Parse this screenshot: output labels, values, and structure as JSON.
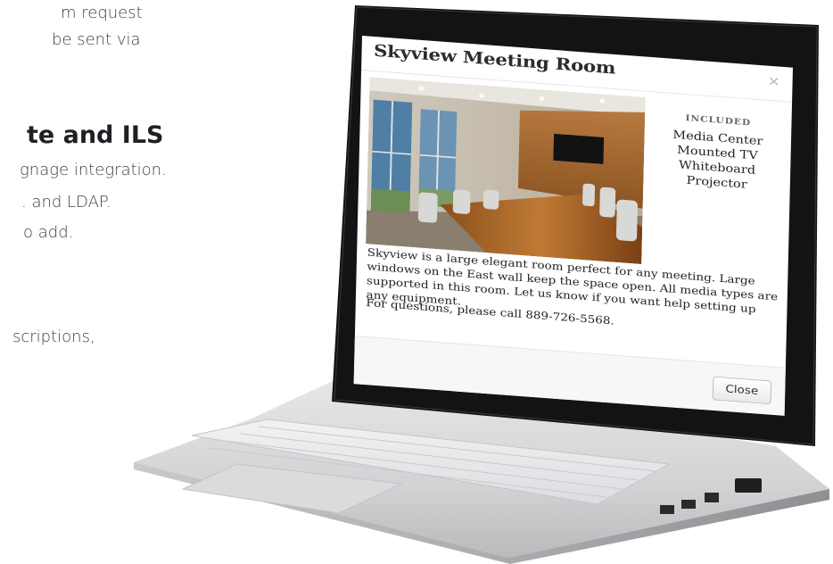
{
  "background_text": {
    "line1": "m request",
    "line2": "be sent via",
    "heading": "te and ILS",
    "line3": "gnage integration.",
    "line4": ". and LDAP.",
    "line5": "o add.",
    "line6": "scriptions,"
  },
  "modal": {
    "title": "Skyview Meeting Room",
    "close_icon": "×",
    "included": {
      "heading": "INCLUDED",
      "items": [
        "Media Center",
        "Mounted TV",
        "Whiteboard",
        "Projector"
      ]
    },
    "description": "Skyview is a large elegant room perfect for any meeting. Large windows on the East wall keep the space open. All media types are supported in this room. Let us know if you want help setting up any equipment.",
    "contact": "For questions, please call 889-726-5568.",
    "close_button": "Close"
  },
  "colors": {
    "text_dark": "#3d4047",
    "laptop_silver": "#d9dadc",
    "bezel": "#141414"
  }
}
